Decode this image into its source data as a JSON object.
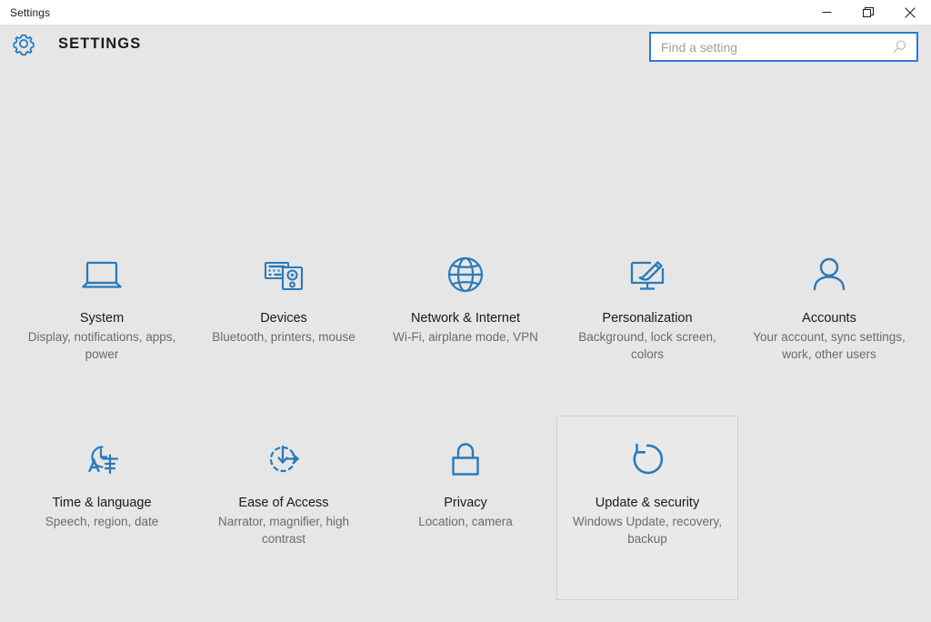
{
  "window": {
    "titlebar_title": "Settings",
    "controls": [
      {
        "name": "minimize-button",
        "label": "Minimize",
        "icon": "minimize-icon"
      },
      {
        "name": "restore-button",
        "label": "Restore",
        "icon": "restore-icon"
      },
      {
        "name": "close-button",
        "label": "Close",
        "icon": "close-icon"
      }
    ]
  },
  "header": {
    "gear_icon": "gear-icon",
    "title": "SETTINGS"
  },
  "search": {
    "placeholder": "Find a setting",
    "value": "",
    "icon": "search-icon",
    "focused": true,
    "border_color": "#2b7cd3"
  },
  "theme": {
    "page_background": "#e6e6e6",
    "titlebar_background": "#ffffff",
    "accent_icon_color": "#2a7ab9",
    "label_color": "#1a1a1a",
    "description_color": "#6b6b6b",
    "selected_tile_border": "#d2d2d2",
    "selected_tile_background": "#e9e9e9"
  },
  "tiles": [
    {
      "id": "system",
      "icon": "laptop-icon",
      "label": "System",
      "description": "Display, notifications, apps, power",
      "selected": false
    },
    {
      "id": "devices",
      "icon": "keyboard-printer-icon",
      "label": "Devices",
      "description": "Bluetooth, printers, mouse",
      "selected": false
    },
    {
      "id": "network-internet",
      "icon": "globe-icon",
      "label": "Network & Internet",
      "description": "Wi-Fi, airplane mode, VPN",
      "selected": false
    },
    {
      "id": "personalization",
      "icon": "monitor-brush-icon",
      "label": "Personalization",
      "description": "Background, lock screen, colors",
      "selected": false
    },
    {
      "id": "accounts",
      "icon": "person-icon",
      "label": "Accounts",
      "description": "Your account, sync settings, work, other users",
      "selected": false
    },
    {
      "id": "time-language",
      "icon": "clock-language-icon",
      "label": "Time & language",
      "description": "Speech, region, date",
      "selected": false
    },
    {
      "id": "ease-of-access",
      "icon": "accessibility-dashed-circle-icon",
      "label": "Ease of Access",
      "description": "Narrator, magnifier, high contrast",
      "selected": false
    },
    {
      "id": "privacy",
      "icon": "lock-icon",
      "label": "Privacy",
      "description": "Location, camera",
      "selected": false
    },
    {
      "id": "update-security",
      "icon": "refresh-circle-icon",
      "label": "Update & security",
      "description": "Windows Update, recovery, backup",
      "selected": true
    }
  ]
}
